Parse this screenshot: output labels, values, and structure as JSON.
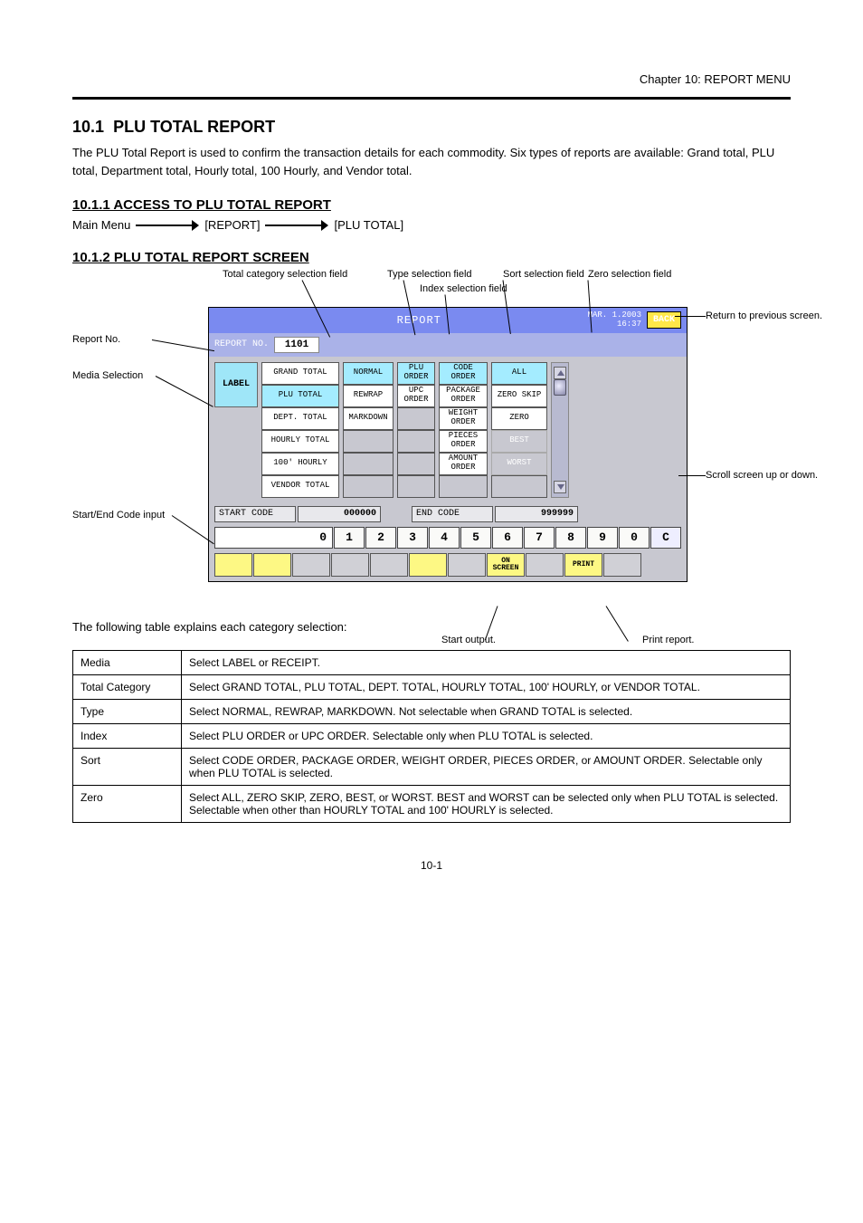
{
  "page": {
    "chapter_ref": "Chapter 10: REPORT MENU",
    "section_num": "10.1",
    "section_title": "PLU TOTAL REPORT",
    "intro": "The PLU Total Report is used to confirm the transaction details for each commodity. Six types of reports are available: Grand total, PLU total, Department total, Hourly total, 100 Hourly, and Vendor total.",
    "flow_heading": "10.1.1 ACCESS TO PLU TOTAL REPORT",
    "flow_steps": [
      "Main Menu",
      "[REPORT]",
      "[PLU TOTAL]"
    ],
    "layout_heading": "10.1.2 PLU TOTAL REPORT SCREEN",
    "page_no": "10-1"
  },
  "annot": {
    "media": "Media Selection",
    "rno": "Report No.",
    "total": "Total category selection field",
    "type": "Type selection field",
    "idx": "Index selection field",
    "sort": "Sort selection field",
    "zero": "Zero selection field",
    "back": "Return to previous screen.",
    "scroll": "Scroll screen up or down.",
    "startend": "Start/End Code input",
    "onscreen": "Start output.",
    "print": "Print report."
  },
  "device": {
    "title": "REPORT",
    "date": "MAR. 1.2003",
    "time": "16:37",
    "back": "BACK",
    "rno_label": "REPORT NO.",
    "rno_value": "1101",
    "media": "LABEL",
    "totals": [
      "GRAND TOTAL",
      "PLU TOTAL",
      "DEPT. TOTAL",
      "HOURLY TOTAL",
      "100' HOURLY",
      "VENDOR TOTAL"
    ],
    "types": [
      "NORMAL",
      "REWRAP",
      "MARKDOWN",
      "",
      "",
      ""
    ],
    "indexes": [
      "PLU ORDER",
      "UPC ORDER",
      "",
      "",
      "",
      ""
    ],
    "sorts": [
      "CODE ORDER",
      "PACKAGE ORDER",
      "WEIGHT ORDER",
      "PIECES ORDER",
      "AMOUNT ORDER",
      ""
    ],
    "zeros": [
      "ALL",
      "ZERO SKIP",
      "ZERO",
      "BEST",
      "WORST",
      ""
    ],
    "start_label": "START CODE",
    "start_value": "000000",
    "end_label": "END CODE",
    "end_value": "999999",
    "keypad_wide": "0",
    "keypad": [
      "1",
      "2",
      "3",
      "4",
      "5",
      "6",
      "7",
      "8",
      "9",
      "0",
      "C"
    ],
    "fn_onscreen": "ON SCREEN",
    "fn_print": "PRINT"
  },
  "desc": {
    "intro": "The following table explains each category selection:",
    "rows": [
      {
        "k": "Media",
        "v": "Select LABEL or RECEIPT."
      },
      {
        "k": "Total Category",
        "v": "Select GRAND TOTAL, PLU TOTAL, DEPT. TOTAL, HOURLY TOTAL, 100' HOURLY, or VENDOR TOTAL."
      },
      {
        "k": "Type",
        "v": "Select NORMAL, REWRAP, MARKDOWN.  Not selectable when GRAND TOTAL is selected."
      },
      {
        "k": "Index",
        "v": "Select PLU ORDER or UPC ORDER.  Selectable only when PLU TOTAL is selected."
      },
      {
        "k": "Sort",
        "v": "Select CODE ORDER, PACKAGE ORDER, WEIGHT ORDER, PIECES ORDER, or AMOUNT ORDER.  Selectable only when PLU TOTAL is selected."
      },
      {
        "k": "Zero",
        "v": "Select ALL, ZERO SKIP, ZERO, BEST, or WORST.  BEST and WORST can be selected only when PLU TOTAL is selected.  Selectable when other than HOURLY TOTAL and 100' HOURLY is selected."
      }
    ]
  }
}
